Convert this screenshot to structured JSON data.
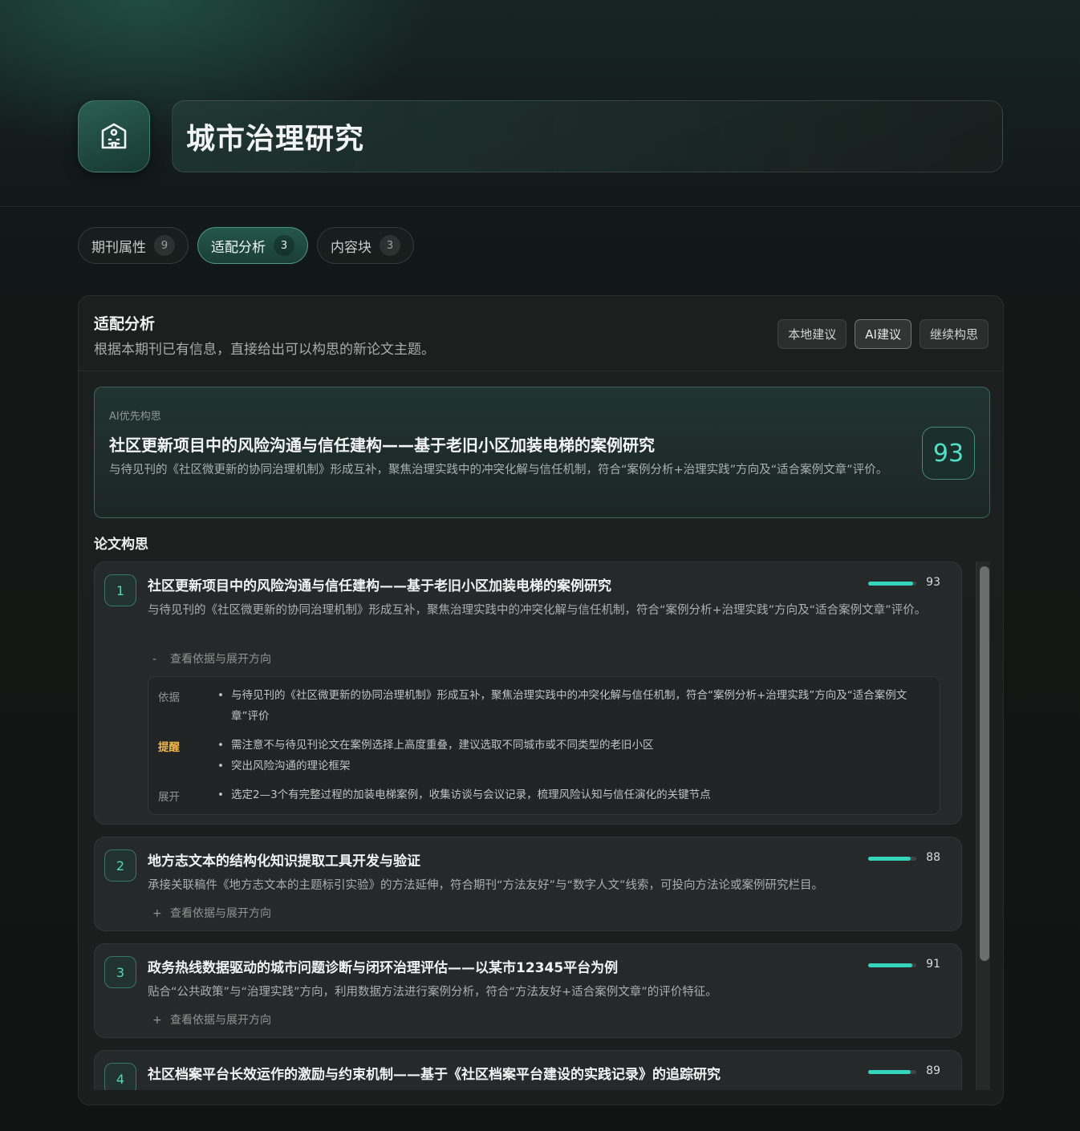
{
  "header": {
    "logo_icon": "building-icon",
    "title": "城市治理研究"
  },
  "tabs": [
    {
      "label": "期刊属性",
      "count": "9",
      "active": false
    },
    {
      "label": "适配分析",
      "count": "3",
      "active": true
    },
    {
      "label": "内容块",
      "count": "3",
      "active": false
    }
  ],
  "panel": {
    "title": "适配分析",
    "subtitle": "根据本期刊已有信息，直接给出可以构思的新论文主题。",
    "buttons": [
      {
        "label": "本地建议",
        "active": false
      },
      {
        "label": "AI建议",
        "active": true
      },
      {
        "label": "继续构思",
        "active": false
      }
    ]
  },
  "featured": {
    "label": "AI优先构思",
    "title": "社区更新项目中的风险沟通与信任建构——基于老旧小区加装电梯的案例研究",
    "description": "与待见刊的《社区微更新的协同治理机制》形成互补，聚焦治理实践中的冲突化解与信任机制，符合“案例分析+治理实践”方向及“适合案例文章”评价。",
    "score": "93"
  },
  "ideas": {
    "section_title": "论文构思",
    "toggle_label": "查看依据与展开方向",
    "items": [
      {
        "index": "1",
        "title": "社区更新项目中的风险沟通与信任建构——基于老旧小区加装电梯的案例研究",
        "score": "93",
        "score_fraction": 0.93,
        "expanded": true,
        "toggle_symbol": "-",
        "description": "与待见刊的《社区微更新的协同治理机制》形成互补，聚焦治理实践中的冲突化解与信任机制，符合“案例分析+治理实践”方向及“适合案例文章”评价。",
        "details": {
          "basis_label": "依据",
          "basis": [
            "与待见刊的《社区微更新的协同治理机制》形成互补，聚焦治理实践中的冲突化解与信任机制，符合“案例分析+治理实践”方向及“适合案例文章”评价"
          ],
          "warn_label": "提醒",
          "warn": [
            "需注意不与待见刊论文在案例选择上高度重叠，建议选取不同城市或不同类型的老旧小区",
            "突出风险沟通的理论框架"
          ],
          "expand_label": "展开",
          "expand": [
            "选定2—3个有完整过程的加装电梯案例，收集访谈与会议记录，梳理风险认知与信任演化的关键节点"
          ]
        }
      },
      {
        "index": "2",
        "title": "地方志文本的结构化知识提取工具开发与验证",
        "score": "88",
        "score_fraction": 0.88,
        "expanded": false,
        "toggle_symbol": "+",
        "description": "承接关联稿件《地方志文本的主题标引实验》的方法延伸，符合期刊“方法友好”与“数字人文”线索，可投向方法论或案例研究栏目。"
      },
      {
        "index": "3",
        "title": "政务热线数据驱动的城市问题诊断与闭环治理评估——以某市12345平台为例",
        "score": "91",
        "score_fraction": 0.91,
        "expanded": false,
        "toggle_symbol": "+",
        "description": "贴合“公共政策”与“治理实践”方向，利用数据方法进行案例分析，符合“方法友好+适合案例文章”的评价特征。"
      },
      {
        "index": "4",
        "title": "社区档案平台长效运作的激励与约束机制——基于《社区档案平台建设的实践记录》的追踪研究",
        "score": "89",
        "score_fraction": 0.89
      }
    ]
  },
  "colors": {
    "accent": "#35d4bc",
    "warning": "#f2b94a"
  }
}
